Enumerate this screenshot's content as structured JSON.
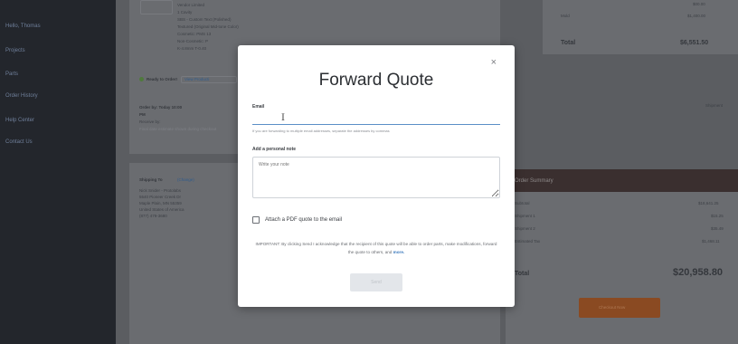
{
  "sidebar": {
    "items": [
      "Hello, Thomas",
      "Projects",
      "Parts",
      "Order History",
      "Help Center",
      "Contact Us"
    ]
  },
  "background": {
    "part_specs": [
      "Vendor Limited",
      "1 Cavity",
      "SBS - Custom Text (Polished)",
      "Textured (Original Mid-tone Color)",
      "Cosmetic: PMS 13",
      "Non-Cosmetic: P",
      "K-4.8mm T-0.40"
    ],
    "ready_label": "Ready to Order!",
    "view_link": "View Producti",
    "order_by": "Order by: Today 10:00",
    "order_by_pm": "PM",
    "receive_by": "Receive by:",
    "date_note": "Final date estimate shown during checkout",
    "ship_to": "Shipping To",
    "change": "(Change)",
    "address": [
      "Nick Snider - Protolabs",
      "5540 Pioneer Creek Dr",
      "Maple Plain, MN 55359",
      "United States of America",
      "(877) 479-3680"
    ],
    "mold_label": "Mold",
    "mold_value": "$1,400.00",
    "top_row_value": "$00.00",
    "total_label": "Total",
    "total_value": "$6,551.50",
    "shipment_btn": "Shipment",
    "summary_title": "Order Summary",
    "subtotal_label": "Subtotal",
    "subtotal_value": "$18,641.25",
    "shipment1_label": "Shipment 1",
    "shipment1_value": "$15.25",
    "shipment2_label": "Shipment 2",
    "shipment2_value": "$35.49",
    "tax_label": "Estimated Tax",
    "tax_value": "$1,468.11",
    "grand_total_label": "Total",
    "grand_total_value": "$20,958.80",
    "checkout_label": "Checkout Now"
  },
  "modal": {
    "title": "Forward Quote",
    "close": "×",
    "email_label": "Email",
    "email_value": "",
    "email_hint": "If you are forwarding to multiple email addresses, separate the addresses by commas",
    "note_label": "Add a personal note",
    "note_placeholder": "Write your note",
    "attach_label": "Attach a PDF quote to the email",
    "important_text": "IMPORTANT: By clicking Send I acknowledge that the recipient of this quote will be able to order parts, make modifications, forward the quote to others, and",
    "more_link": "more.",
    "send_label": "Send"
  }
}
